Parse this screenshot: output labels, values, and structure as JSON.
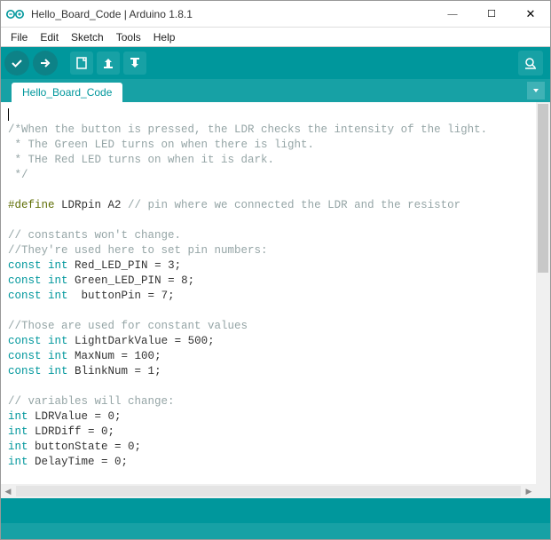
{
  "window": {
    "title": "Hello_Board_Code | Arduino 1.8.1"
  },
  "menu": {
    "file": "File",
    "edit": "Edit",
    "sketch": "Sketch",
    "tools": "Tools",
    "help": "Help"
  },
  "tab": {
    "name": "Hello_Board_Code"
  },
  "code": {
    "l1": "/*When the button is pressed, the LDR checks the intensity of the light.",
    "l2": " * The Green LED turns on when there is light.",
    "l3": " * THe Red LED turns on when it is dark.",
    "l4": " */",
    "l6a": "#define",
    "l6b": " LDRpin A2 ",
    "l6c": "// pin where we connected the LDR and the resistor",
    "l8": "// constants won't change.",
    "l9": "//They're used here to set pin numbers:",
    "kw_const": "const",
    "kw_int": "int",
    "l10v": " Red_LED_PIN = 3;",
    "l11v": " Green_LED_PIN = 8;",
    "l12v": "  buttonPin = 7;",
    "l14": "//Those are used for constant values",
    "l15v": " LightDarkValue = 500;",
    "l16v": " MaxNum = 100;",
    "l17v": " BlinkNum = 1;",
    "l19": "// variables will change:",
    "l20v": " LDRValue = 0;",
    "l21v": " LDRDiff = 0;",
    "l22v": " buttonState = 0;",
    "l23v": " DelayTime = 0;"
  }
}
